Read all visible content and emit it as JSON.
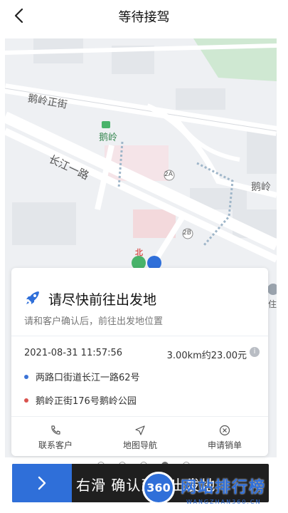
{
  "header": {
    "title": "等待接驾"
  },
  "map": {
    "streets": [
      "鹅岭正街",
      "长江一路"
    ],
    "pois": [
      "鹅岭",
      "鹅岭"
    ],
    "exits": [
      "2A",
      "2B"
    ],
    "marker_label": "北",
    "side_label": "住"
  },
  "card": {
    "title": "请尽快前往出发地",
    "subtitle": "请和客户确认后，前往出发地位置",
    "time": "2021-08-31  11:57:56",
    "price": "3.00km约23.00元",
    "origin": "两路口街道长江一路62号",
    "destination": "鹅岭正街176号鹅岭公园",
    "actions": [
      {
        "label": "联系客户"
      },
      {
        "label": "地图导航"
      },
      {
        "label": "申请销单"
      }
    ]
  },
  "slider": {
    "label": "右滑  确认到达出发地"
  },
  "watermark": {
    "badge": "360",
    "text": "网站排行榜",
    "url": "WANGZHAN360.CN"
  },
  "colors": {
    "accent": "#2f6fd9",
    "origin_dot": "#3b73d6",
    "dest_dot": "#d9534f"
  }
}
